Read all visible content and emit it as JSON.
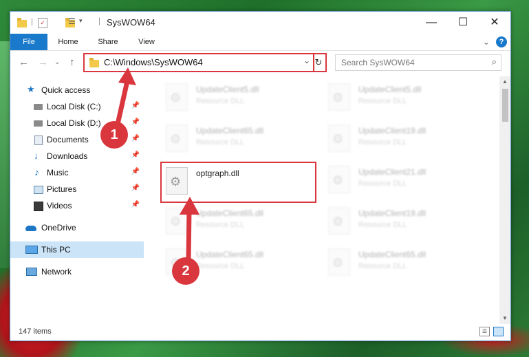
{
  "window": {
    "title": "SysWOW64",
    "minimize": "—",
    "maximize": "☐",
    "close": "✕"
  },
  "ribbon": {
    "tabs": [
      "File",
      "Home",
      "Share",
      "View"
    ],
    "expand": "⌄",
    "help": "?"
  },
  "address": {
    "path": "C:\\Windows\\SysWOW64",
    "dropdown": "⌄",
    "refresh": "↻"
  },
  "search": {
    "placeholder": "Search SysWOW64"
  },
  "nav": {
    "back": "←",
    "forward": "→",
    "recent": "⌄",
    "up": "↑",
    "items": [
      {
        "label": "Quick access"
      },
      {
        "label": "Local Disk (C:)"
      },
      {
        "label": "Local Disk (D:)"
      },
      {
        "label": "Documents"
      },
      {
        "label": "Downloads"
      },
      {
        "label": "Music"
      },
      {
        "label": "Pictures"
      },
      {
        "label": "Videos"
      },
      {
        "label": "OneDrive"
      },
      {
        "label": "This PC"
      },
      {
        "label": "Network"
      }
    ]
  },
  "files": [
    {
      "name": "UpdateClient5.dll",
      "type": "Resource DLL"
    },
    {
      "name": "UpdateClient5.dll",
      "type": "Resource DLL"
    },
    {
      "name": "UpdateClient65.dll",
      "type": "Resource DLL"
    },
    {
      "name": "UpdateClient19.dll",
      "type": "Resource DLL"
    },
    {
      "name": "optgraph.dll",
      "type": ""
    },
    {
      "name": "UpdateClient21.dll",
      "type": "Resource DLL"
    },
    {
      "name": "UpdateClient65.dll",
      "type": "Resource DLL"
    },
    {
      "name": "UpdateClient19.dll",
      "type": "Resource DLL"
    },
    {
      "name": "UpdateClient65.dll",
      "type": "Resource DLL"
    },
    {
      "name": "UpdateClient65.dll",
      "type": "Resource DLL"
    }
  ],
  "status": {
    "count": "147 items"
  },
  "callouts": {
    "one": "1",
    "two": "2"
  },
  "colors": {
    "accent": "#1979ca",
    "highlight": "#d9363e",
    "selected": "#cce4f7"
  }
}
